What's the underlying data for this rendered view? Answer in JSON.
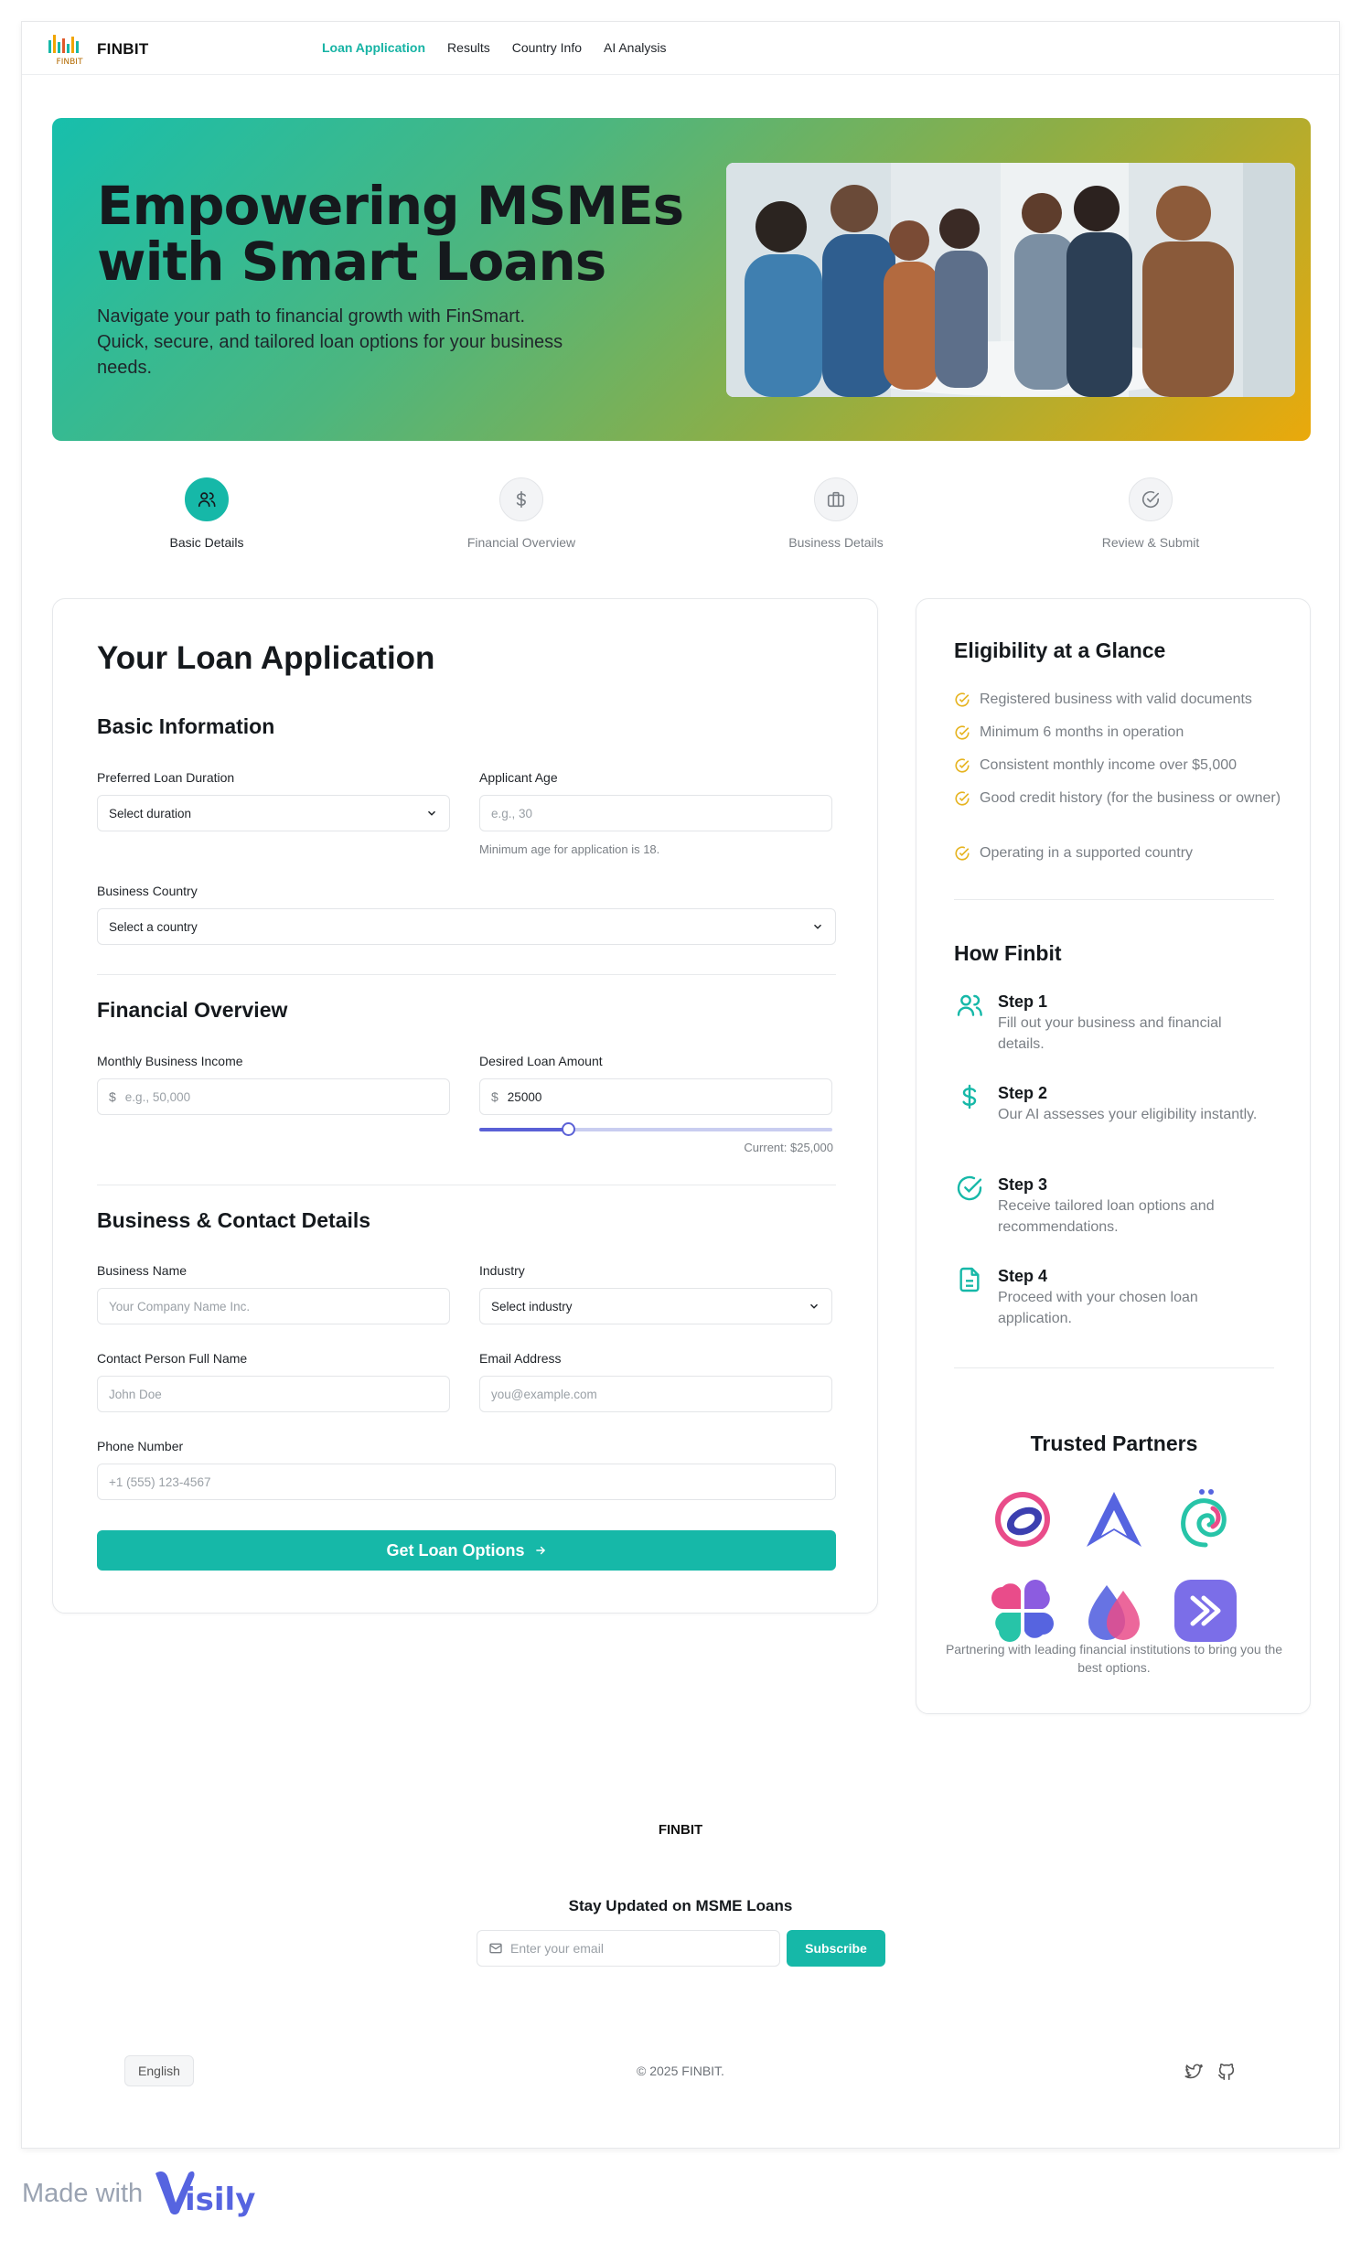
{
  "header": {
    "brand": "FINBIT",
    "logo_text": "FINBIT",
    "nav": [
      {
        "label": "Loan Application",
        "active": true
      },
      {
        "label": "Results",
        "active": false
      },
      {
        "label": "Country Info",
        "active": false
      },
      {
        "label": "AI Analysis",
        "active": false
      }
    ]
  },
  "hero": {
    "title": "Empowering MSMEs with Smart Loans",
    "subtitle": "Navigate your path to financial growth with FinSmart. Quick, secure, and tailored loan options for your business needs."
  },
  "steps": [
    {
      "label": "Basic Details",
      "icon": "users-icon",
      "active": true
    },
    {
      "label": "Financial Overview",
      "icon": "dollar-icon",
      "active": false
    },
    {
      "label": "Business Details",
      "icon": "briefcase-icon",
      "active": false
    },
    {
      "label": "Review & Submit",
      "icon": "check-circle-icon",
      "active": false
    }
  ],
  "form": {
    "title": "Your Loan Application",
    "basic": {
      "title": "Basic Information",
      "duration_label": "Preferred Loan Duration",
      "duration_value": "Select duration",
      "age_label": "Applicant Age",
      "age_placeholder": "e.g., 30",
      "age_hint": "Minimum age for application is 18.",
      "country_label": "Business Country",
      "country_value": "Select a country"
    },
    "financial": {
      "title": "Financial Overview",
      "income_label": "Monthly Business Income",
      "income_placeholder": "e.g., 50,000",
      "loan_label": "Desired Loan Amount",
      "loan_value": "25000",
      "currency_symbol": "$",
      "slider_fraction": 0.25,
      "current_text": "Current: $25,000"
    },
    "business": {
      "title": "Business & Contact Details",
      "name_label": "Business Name",
      "name_placeholder": "Your Company Name Inc.",
      "industry_label": "Industry",
      "industry_value": "Select industry",
      "contact_label": "Contact Person Full Name",
      "contact_placeholder": "John Doe",
      "email_label": "Email Address",
      "email_placeholder": "you@example.com",
      "phone_label": "Phone Number",
      "phone_placeholder": "+1 (555) 123-4567"
    },
    "submit_label": "Get Loan Options"
  },
  "sidebar": {
    "eligibility_title": "Eligibility at a Glance",
    "eligibility": [
      "Registered business with valid documents",
      "Minimum 6 months in operation",
      "Consistent monthly income over $5,000",
      "Good credit history (for the business or owner)",
      "Operating in a supported country"
    ],
    "how_title": "How Finbit",
    "how_steps": [
      {
        "title": "Step 1",
        "desc": "Fill out your business and financial details.",
        "icon": "users-icon"
      },
      {
        "title": "Step 2",
        "desc": "Our AI assesses your eligibility instantly.",
        "icon": "dollar-icon"
      },
      {
        "title": "Step 3",
        "desc": "Receive tailored loan options and recommendations.",
        "icon": "check-circle-icon"
      },
      {
        "title": "Step 4",
        "desc": "Proceed with your chosen loan application.",
        "icon": "document-icon"
      }
    ],
    "partners_title": "Trusted Partners",
    "partners_note": "Partnering with leading financial institutions to bring you the best options."
  },
  "footer": {
    "brand": "FINBIT",
    "stay_title": "Stay Updated on MSME Loans",
    "email_placeholder": "Enter your email",
    "subscribe_label": "Subscribe",
    "language": "English",
    "copyright": "© 2025 FINBIT."
  },
  "madewith": {
    "text": "Made with",
    "brand": "Visily"
  },
  "colors": {
    "accent": "#16b8a8",
    "slider": "#5a60d6",
    "check": "#e6b422"
  }
}
